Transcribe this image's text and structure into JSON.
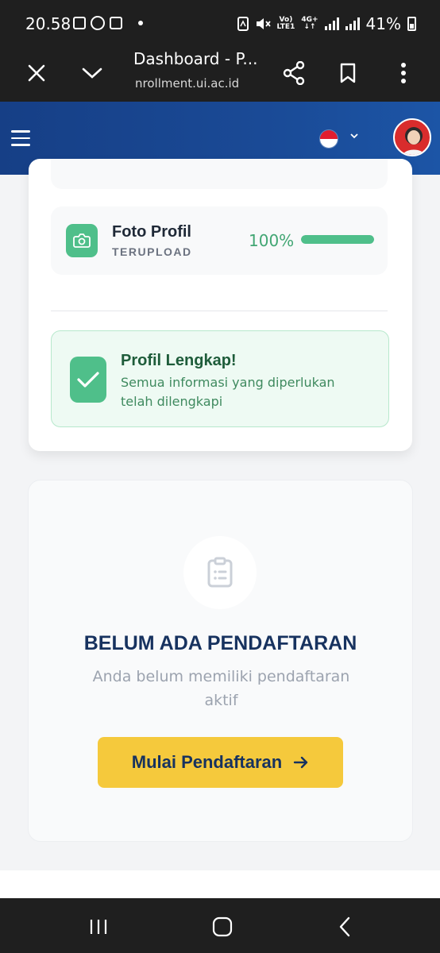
{
  "status_bar": {
    "time": "20.58",
    "network_top": "Vo)",
    "network_bottom": "LTE1",
    "network_type": "4G+",
    "battery": "41%"
  },
  "browser": {
    "title": "Dashboard - P...",
    "url": "nrollment.ui.ac.id"
  },
  "header": {
    "language_flag": "indonesia-flag-icon",
    "brand_color": "#163f86"
  },
  "profile_items": [
    {
      "title": "Foto Profil",
      "status": "TERUPLOAD",
      "percent_label": "100%",
      "progress": 1.0,
      "icon": "camera-icon"
    }
  ],
  "profile_complete": {
    "title": "Profil Lengkap!",
    "description": "Semua informasi yang diperlukan telah dilengkapi",
    "icon": "check-icon"
  },
  "empty_state": {
    "icon": "clipboard-icon",
    "title": "BELUM ADA PENDAFTARAN",
    "description": "Anda belum memiliki pendaftaran aktif",
    "button_label": "Mulai Pendaftaran",
    "button_color": "#f5c93c"
  },
  "colors": {
    "success": "#4fbf8a",
    "accent": "#17325f"
  }
}
